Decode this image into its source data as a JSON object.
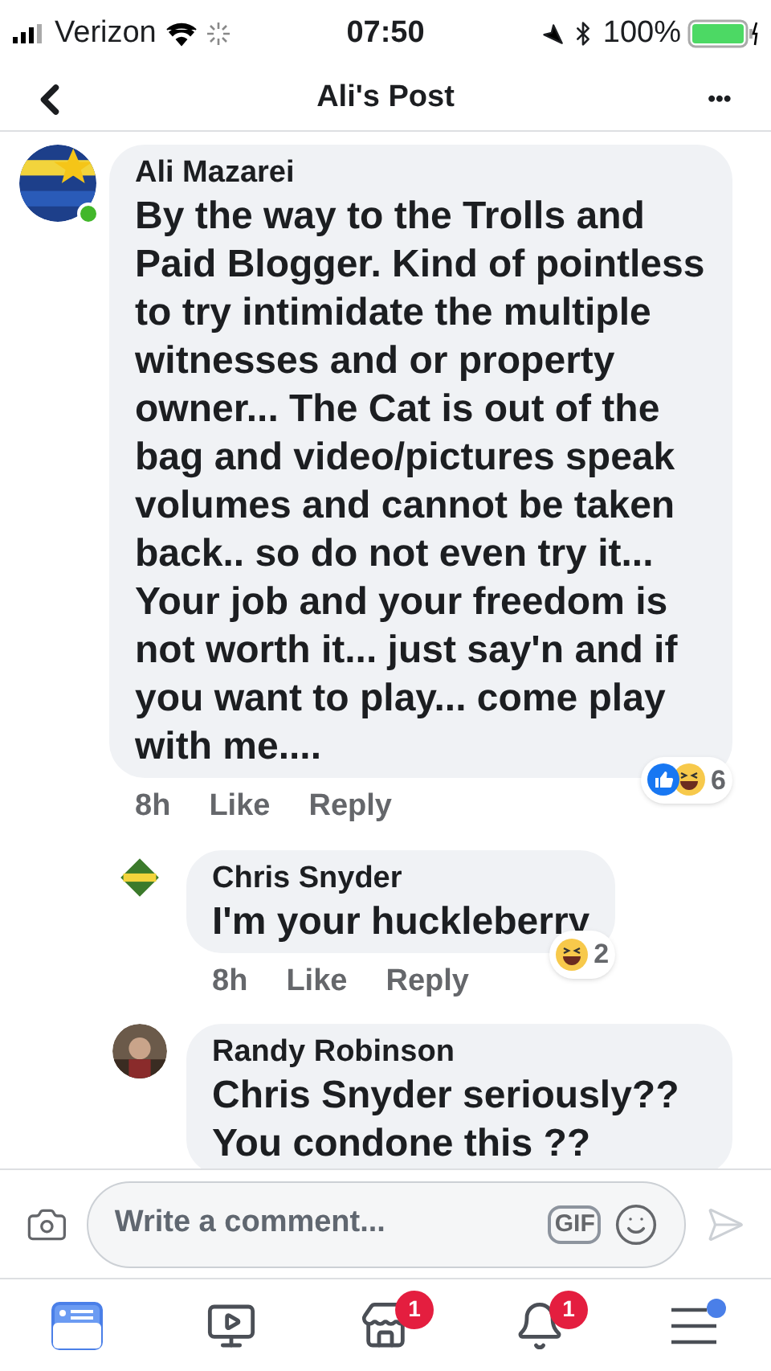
{
  "status_bar": {
    "carrier": "Verizon",
    "time": "07:50",
    "battery": "100%"
  },
  "header": {
    "title": "Ali's Post",
    "more": "•••"
  },
  "comments": [
    {
      "kind": "comment",
      "author": "Ali Mazarei",
      "text": "By the way to the Trolls and Paid Blogger. Kind of pointless to try intimidate the multiple witnesses and or property owner... The Cat is out of the bag and video/pictures speak volumes and cannot be taken back.. so do not even try it... Your job and your freedom is not worth it... just say'n and if you want to play... come play with me....",
      "online": true,
      "time": "8h",
      "like": "Like",
      "reply": "Reply",
      "reactions": [
        {
          "kind": "like"
        },
        {
          "kind": "haha"
        }
      ],
      "reaction_count": "6"
    },
    {
      "kind": "reply",
      "author": "Chris Snyder",
      "text": "I'm your huckleberry",
      "online": false,
      "time": "8h",
      "like": "Like",
      "reply": "Reply",
      "reactions": [
        {
          "kind": "haha"
        }
      ],
      "reaction_count": "2"
    },
    {
      "kind": "reply",
      "author": "Randy Robinson",
      "text": "Chris Snyder seriously?? You condone this ??",
      "online": false
    }
  ],
  "composer": {
    "placeholder": "Write a comment...",
    "gif": "GIF"
  },
  "nav": [
    {
      "selected": true
    },
    {
      "selected": false
    },
    {
      "selected": false,
      "badge": "1"
    },
    {
      "selected": false,
      "badge": "1"
    },
    {
      "selected": false,
      "dot": true
    }
  ]
}
